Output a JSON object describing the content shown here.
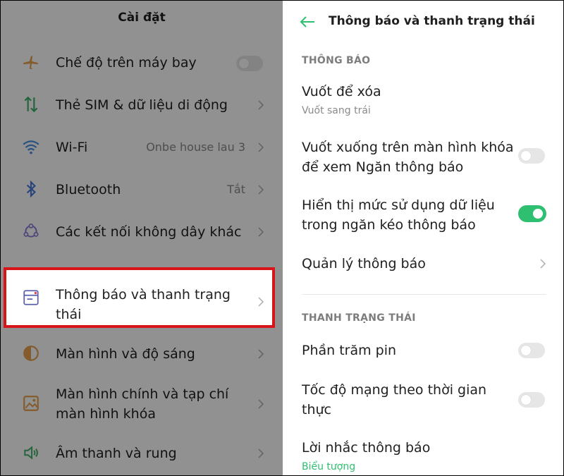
{
  "settings": {
    "title": "Cài đặt",
    "items": [
      {
        "label": "Chế độ trên máy bay",
        "icon": "airplane-icon",
        "control": "toggle-off"
      },
      {
        "label": "Thẻ SIM & dữ liệu di động",
        "icon": "sim-data-icon"
      },
      {
        "label": "Wi-Fi",
        "value": "Onbe house lau 3",
        "icon": "wifi-icon"
      },
      {
        "label": "Bluetooth",
        "value": "Tắt",
        "icon": "bluetooth-icon"
      },
      {
        "label": "Các kết nối không dây khác",
        "icon": "wireless-connections-icon"
      },
      {
        "label_line1": "Thông báo và thanh trạng",
        "label_line2": "thái",
        "icon": "notification-bar-icon",
        "highlighted": true
      },
      {
        "label": "Màn hình và độ sáng",
        "icon": "brightness-icon"
      },
      {
        "label_line1": "Màn hình chính và tạp chí",
        "label_line2": "màn hình khóa",
        "icon": "wallpaper-icon"
      },
      {
        "label": "Âm thanh và rung",
        "icon": "sound-icon"
      }
    ]
  },
  "notifications_screen": {
    "title": "Thông báo và thanh trạng thái",
    "sections": [
      {
        "header": "THÔNG BÁO",
        "items": [
          {
            "title": "Vuốt để xóa",
            "subtitle": "Vuốt sang trái"
          },
          {
            "title_line1": "Vuốt xuống trên màn hình khóa",
            "title_line2": "để xem Ngăn thông báo",
            "toggle": "off"
          },
          {
            "title_line1": "Hiển thị mức sử dụng dữ liệu",
            "title_line2": "trong ngăn kéo thông báo",
            "toggle": "on"
          },
          {
            "title": "Quản lý thông báo"
          }
        ]
      },
      {
        "header": "THANH TRẠNG THÁI",
        "items": [
          {
            "title": "Phần trăm pin",
            "toggle": "off"
          },
          {
            "title_line1": "Tốc độ mạng theo thời gian",
            "title_line2": "thực",
            "toggle": "off"
          },
          {
            "title": "Lời nhắc thông báo",
            "subtitle": "Biểu tượng"
          }
        ]
      }
    ]
  },
  "colors": {
    "accent": "#2fbf71",
    "highlight_border": "#d8141b",
    "icon_tint": "#5a5fb0",
    "overlay": "rgba(0,0,0,0.43)"
  }
}
